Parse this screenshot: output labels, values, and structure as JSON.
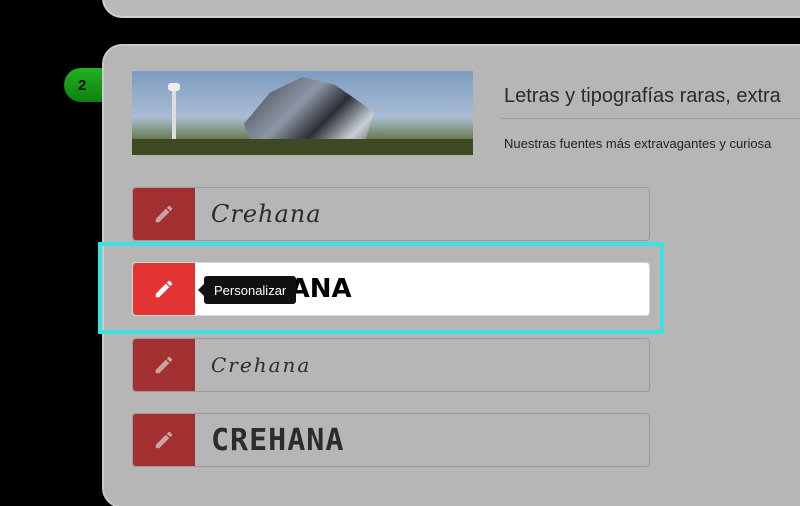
{
  "step": {
    "number": "2"
  },
  "collection": {
    "title": "Letras y tipografías raras, extra",
    "description": "Nuestras fuentes más extravagantes y curiosa"
  },
  "fonts": [
    {
      "sample": "Crehana"
    },
    {
      "sample": "CREHANA"
    },
    {
      "sample": "Crehana"
    },
    {
      "sample": "CREHANA"
    }
  ],
  "tooltip": {
    "label": "Personalizar"
  },
  "colors": {
    "highlight": "#3fe0e0",
    "edit_active": "#e43333",
    "edit_dimmed": "#a33030",
    "badge": "#1a9a1a"
  },
  "icons": {
    "edit": "pencil-icon"
  }
}
